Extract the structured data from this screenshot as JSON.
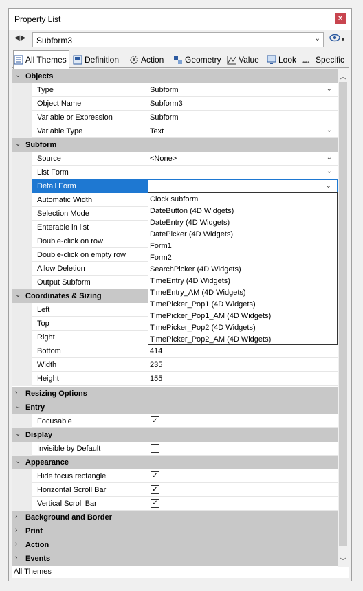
{
  "window": {
    "title": "Property List",
    "close_label": "×"
  },
  "object_selector": {
    "nav_label": "◀▶",
    "value": "Subform3"
  },
  "tabs": [
    {
      "label": "All Themes",
      "active": true
    },
    {
      "label": "Definition"
    },
    {
      "label": "Action"
    },
    {
      "label": "Geometry"
    },
    {
      "label": "Value"
    },
    {
      "label": "Look"
    },
    {
      "label": "Specific"
    }
  ],
  "sections": {
    "objects": "Objects",
    "subform": "Subform",
    "coordinates": "Coordinates & Sizing",
    "resizing": "Resizing Options",
    "entry": "Entry",
    "display": "Display",
    "appearance": "Appearance",
    "background": "Background and Border",
    "print": "Print",
    "action": "Action",
    "events": "Events"
  },
  "properties": {
    "type": {
      "name": "Type",
      "value": "Subform"
    },
    "object_name": {
      "name": "Object Name",
      "value": "Subform3"
    },
    "variable": {
      "name": "Variable or Expression",
      "value": "Subform"
    },
    "variable_type": {
      "name": "Variable Type",
      "value": "Text"
    },
    "source": {
      "name": "Source",
      "value": "<None>"
    },
    "list_form": {
      "name": "List Form",
      "value": ""
    },
    "detail_form": {
      "name": "Detail Form",
      "value": ""
    },
    "automatic_width": {
      "name": "Automatic Width"
    },
    "selection_mode": {
      "name": "Selection Mode"
    },
    "enterable_in_list": {
      "name": "Enterable in list"
    },
    "double_click_row": {
      "name": "Double-click on row"
    },
    "double_click_empty": {
      "name": "Double-click on empty row"
    },
    "allow_deletion": {
      "name": "Allow Deletion"
    },
    "output_subform": {
      "name": "Output Subform"
    },
    "left": {
      "name": "Left"
    },
    "top": {
      "name": "Top"
    },
    "right": {
      "name": "Right"
    },
    "bottom": {
      "name": "Bottom",
      "value": "414"
    },
    "width": {
      "name": "Width",
      "value": "235"
    },
    "height": {
      "name": "Height",
      "value": "155"
    },
    "focusable": {
      "name": "Focusable",
      "checked": true
    },
    "invisible_default": {
      "name": "Invisible by Default",
      "checked": false
    },
    "hide_focus": {
      "name": "Hide focus rectangle",
      "checked": true
    },
    "h_scroll": {
      "name": "Horizontal Scroll Bar",
      "checked": true
    },
    "v_scroll": {
      "name": "Vertical Scroll Bar",
      "checked": true
    }
  },
  "detail_form_options": [
    "Clock subform",
    "DateButton (4D Widgets)",
    "DateEntry (4D Widgets)",
    "DatePicker (4D Widgets)",
    "Form1",
    "Form2",
    "SearchPicker (4D Widgets)",
    "TimeEntry (4D Widgets)",
    "TimeEntry_AM (4D Widgets)",
    "TimePicker_Pop1 (4D Widgets)",
    "TimePicker_Pop1_AM (4D Widgets)",
    "TimePicker_Pop2 (4D Widgets)",
    "TimePicker_Pop2_AM (4D Widgets)"
  ],
  "status": {
    "text": "All Themes"
  },
  "colors": {
    "accent": "#1e78d2",
    "section_bg": "#c8c8c8",
    "close_bg": "#c8454f"
  }
}
